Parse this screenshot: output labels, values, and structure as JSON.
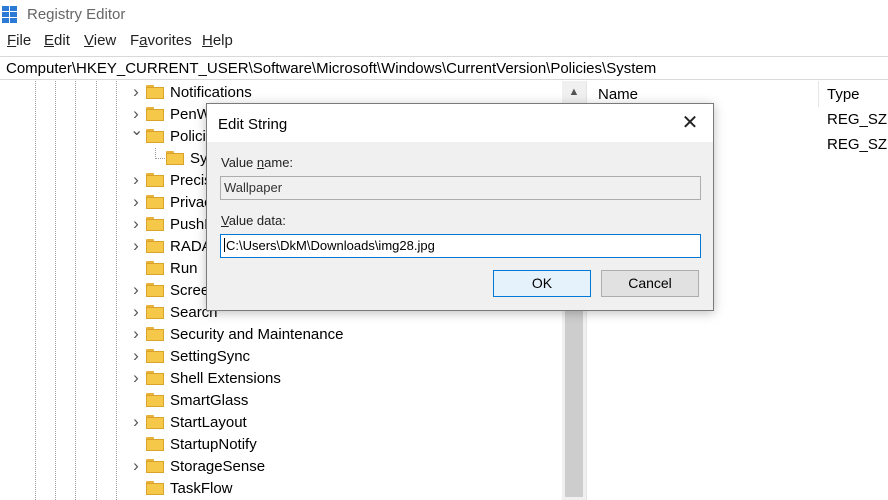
{
  "window": {
    "title": "Registry Editor"
  },
  "menu": [
    {
      "label": "File",
      "accel": "F"
    },
    {
      "label": "Edit",
      "accel": "E"
    },
    {
      "label": "View",
      "accel": "V"
    },
    {
      "label": "Favorites",
      "accel": "a"
    },
    {
      "label": "Help",
      "accel": "H"
    }
  ],
  "address": {
    "path": "Computer\\HKEY_CURRENT_USER\\Software\\Microsoft\\Windows\\CurrentVersion\\Policies\\System"
  },
  "tree": {
    "items": [
      {
        "label": "Notifications",
        "expander": "right"
      },
      {
        "label": "PenW",
        "expander": "right"
      },
      {
        "label": "Policie",
        "expander": "down"
      },
      {
        "label": "Sys",
        "expander": "none",
        "child": true
      },
      {
        "label": "Precis",
        "expander": "right"
      },
      {
        "label": "Privac",
        "expander": "right"
      },
      {
        "label": "PushN",
        "expander": "right"
      },
      {
        "label": "RADA",
        "expander": "right"
      },
      {
        "label": "Run",
        "expander": "none"
      },
      {
        "label": "Scree",
        "expander": "right"
      },
      {
        "label": "Search",
        "expander": "right"
      },
      {
        "label": "Security and Maintenance",
        "expander": "right"
      },
      {
        "label": "SettingSync",
        "expander": "right"
      },
      {
        "label": "Shell Extensions",
        "expander": "right"
      },
      {
        "label": "SmartGlass",
        "expander": "none"
      },
      {
        "label": "StartLayout",
        "expander": "right"
      },
      {
        "label": "StartupNotify",
        "expander": "none"
      },
      {
        "label": "StorageSense",
        "expander": "right"
      },
      {
        "label": "TaskFlow",
        "expander": "none"
      }
    ]
  },
  "values_pane": {
    "columns": {
      "name": "Name",
      "type": "Type"
    },
    "rows": [
      {
        "type": "REG_SZ"
      },
      {
        "type": "REG_SZ"
      }
    ]
  },
  "dialog": {
    "title": "Edit String",
    "close_glyph": "✕",
    "value_name_label_pre": "Value ",
    "value_name_label_accel": "n",
    "value_name_label_post": "ame:",
    "value_name": "Wallpaper",
    "value_data_label_pre": "",
    "value_data_label_accel": "V",
    "value_data_label_post": "alue data:",
    "value_data": "C:\\Users\\DkM\\Downloads\\img28.jpg",
    "ok_label": "OK",
    "cancel_label": "Cancel"
  },
  "colors": {
    "accent": "#0078d7",
    "folder": "#f5c84a",
    "app_icon": "#2b7bd6"
  }
}
